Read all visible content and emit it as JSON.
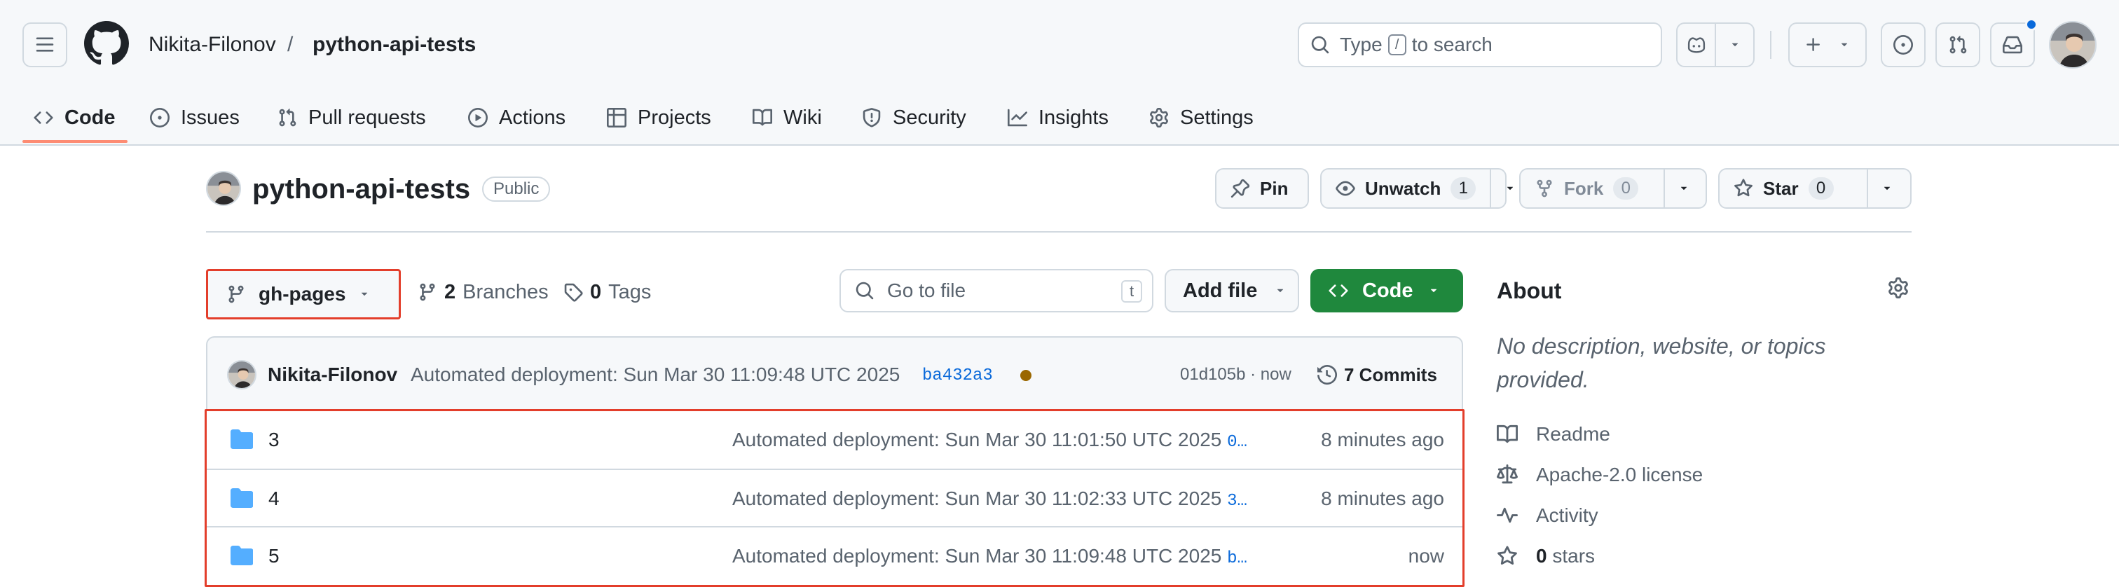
{
  "topbar": {
    "owner": "Nikita-Filonov",
    "separator": "/",
    "repo": "python-api-tests",
    "search_prefix": "Type",
    "search_key": "/",
    "search_suffix": "to search"
  },
  "tabs": [
    {
      "label": "Code",
      "icon": "code-icon",
      "active": true
    },
    {
      "label": "Issues",
      "icon": "issue-icon"
    },
    {
      "label": "Pull requests",
      "icon": "pull-request-icon"
    },
    {
      "label": "Actions",
      "icon": "play-icon"
    },
    {
      "label": "Projects",
      "icon": "table-icon"
    },
    {
      "label": "Wiki",
      "icon": "book-icon"
    },
    {
      "label": "Security",
      "icon": "shield-icon"
    },
    {
      "label": "Insights",
      "icon": "graph-icon"
    },
    {
      "label": "Settings",
      "icon": "gear-icon"
    }
  ],
  "repo": {
    "title": "python-api-tests",
    "visibility": "Public",
    "pin_label": "Pin",
    "unwatch_label": "Unwatch",
    "watch_count": "1",
    "fork_label": "Fork",
    "fork_count": "0",
    "star_label": "Star",
    "star_count": "0"
  },
  "branch_bar": {
    "branch": "gh-pages",
    "branches_count": "2",
    "branches_label": "Branches",
    "tags_count": "0",
    "tags_label": "Tags",
    "goto_placeholder": "Go to file",
    "goto_key": "t",
    "add_file_label": "Add file",
    "code_label": "Code"
  },
  "latest_commit": {
    "author": "Nikita-Filonov",
    "message": "Automated deployment: Sun Mar 30 11:09:48 UTC 2025",
    "hash": "ba432a3",
    "status_color": "#9a6700",
    "meta": "01d105b · now",
    "commits_label": "7 Commits"
  },
  "files": [
    {
      "name": "3",
      "message": "Automated deployment: Sun Mar 30 11:01:50 UTC 2025",
      "hash": "0…",
      "time": "8 minutes ago"
    },
    {
      "name": "4",
      "message": "Automated deployment: Sun Mar 30 11:02:33 UTC 2025",
      "hash": "3…",
      "time": "8 minutes ago"
    },
    {
      "name": "5",
      "message": "Automated deployment: Sun Mar 30 11:09:48 UTC 2025",
      "hash": "b…",
      "time": "now"
    }
  ],
  "about": {
    "title": "About",
    "description": "No description, website, or topics provided.",
    "readme": "Readme",
    "license": "Apache-2.0 license",
    "activity": "Activity",
    "stars_count": "0",
    "stars_label": "stars"
  },
  "colors": {
    "accent": "#0969da",
    "primary_button": "#1f883d",
    "active_tab_underline": "#fd8c73",
    "highlight_box": "#e33e2b",
    "folder": "#54aeff"
  }
}
